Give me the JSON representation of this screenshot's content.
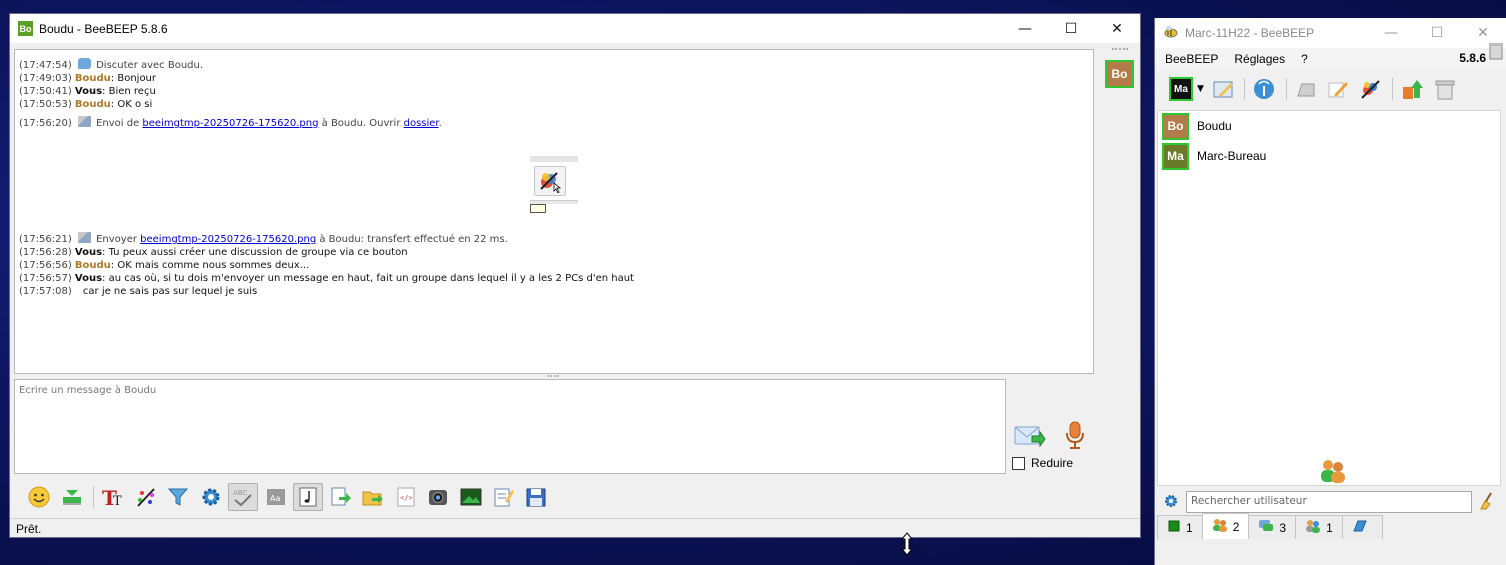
{
  "chat_window": {
    "app_badge": "Bo",
    "title": "Boudu - BeeBEEP 5.8.6",
    "controls": [
      "—",
      "☐",
      "✕"
    ],
    "side_avatar": "Bo",
    "lines": [
      {
        "time": "(17:47:54)",
        "icon": "chat-bubble",
        "text": "Discuter avec Boudu."
      },
      {
        "time": "(17:49:03)",
        "sender": "Boudu",
        "text": ": Bonjour"
      },
      {
        "time": "(17:50:41)",
        "sender": "Vous",
        "text": ": Bien reçu"
      },
      {
        "time": "(17:50:53)",
        "sender": "Boudu",
        "text": ": OK o si"
      },
      {
        "time": "(17:56:20)",
        "icon": "file",
        "prefix": "Envoi de ",
        "link": "beeimgtmp-20250726-175620.png",
        "middle": " à Boudu. Ouvrir ",
        "link2": "dossier",
        "suffix": "."
      }
    ],
    "lines_after": [
      {
        "time": "(17:56:21)",
        "icon": "file",
        "prefix": "Envoyer ",
        "link": "beeimgtmp-20250726-175620.png",
        "suffix": " à Boudu: transfert effectué en 22 ms."
      },
      {
        "time": "(17:56:28)",
        "sender": "Vous",
        "text": ": Tu peux aussi créer une discussion de groupe via ce bouton"
      },
      {
        "time": "(17:56:56)",
        "sender": "Boudu",
        "text": ": OK mais comme nous sommes deux..."
      },
      {
        "time": "(17:56:57)",
        "sender": "Vous",
        "text": ": au cas où, si tu dois m'envoyer un message en haut, fait un groupe dans lequel il y a les 2 PCs d'en haut"
      },
      {
        "time": "(17:57:08)",
        "text": "car je ne sais pas sur lequel je suis"
      }
    ],
    "composer_placeholder": "Ecrire un message à Boudu",
    "reduce_label": "Reduire",
    "status": "Prêt.",
    "toolbar_icons": [
      "emoji-icon",
      "save-chat-icon",
      "font-icon",
      "color-icon",
      "filter-icon",
      "settings-icon",
      "spellcheck-icon",
      "word-completion-icon",
      "music-note-icon",
      "send-file-icon",
      "send-folder-icon",
      "code-icon",
      "screenshot-icon",
      "image-icon",
      "notes-icon",
      "save-icon"
    ]
  },
  "main_window": {
    "title": "Marc-11H22 - BeeBEEP",
    "menu": [
      "BeeBEEP",
      "Réglages",
      "?"
    ],
    "version": "5.8.6",
    "my_avatar": "Ma",
    "users": [
      {
        "avatar": "Bo",
        "name": "Boudu"
      },
      {
        "avatar": "Ma",
        "name": "Marc-Bureau"
      }
    ],
    "search_placeholder": "Rechercher utilisateur",
    "tabs": [
      {
        "icon": "users-icon",
        "count": "1"
      },
      {
        "icon": "group-icon",
        "count": "2"
      },
      {
        "icon": "chats-icon",
        "count": "3"
      },
      {
        "icon": "groups-icon",
        "count": "1"
      },
      {
        "icon": "share-icon",
        "count": ""
      }
    ]
  },
  "colors": {
    "boudu_name": "#b07a2a",
    "link": "#0000cc",
    "online_ring": "#2ec82e",
    "app_badge": "#5aa024"
  }
}
